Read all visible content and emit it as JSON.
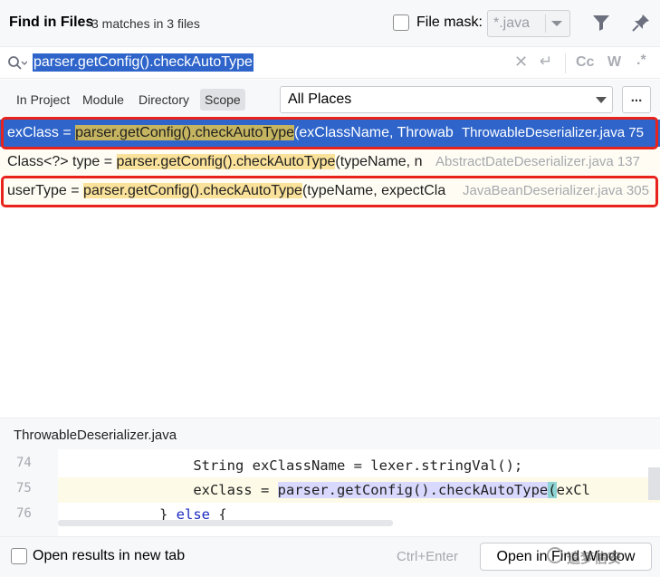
{
  "header": {
    "title": "Find in Files",
    "matches": "3 matches in 3 files",
    "file_mask_label": "File mask:",
    "file_mask_value": "*.java"
  },
  "search": {
    "query": "parser.getConfig().checkAutoType"
  },
  "toolbar": {
    "case_label": "Cc",
    "words_label": "W",
    "regex_label": ".*"
  },
  "scope": {
    "tabs": [
      "In Project",
      "Module",
      "Directory",
      "Scope"
    ],
    "selected_tab": "Scope",
    "places_value": "All Places",
    "more_label": "..."
  },
  "results": [
    {
      "prefix": "exClass = ",
      "match": "parser.getConfig().checkAutoType",
      "suffix": "(exClassName, Throwab",
      "file": "ThrowableDeserializer.java 75",
      "selected": true
    },
    {
      "prefix": "Class<?> type = ",
      "match": "parser.getConfig().checkAutoType",
      "suffix": "(typeName, n",
      "file": "AbstractDateDeserializer.java 137",
      "selected": false
    },
    {
      "prefix": "userType = ",
      "match": "parser.getConfig().checkAutoType",
      "suffix": "(typeName, expectCla",
      "file": "JavaBeanDeserializer.java 305",
      "selected": false
    }
  ],
  "preview": {
    "file_name": "ThrowableDeserializer.java",
    "lines": [
      {
        "number": "74",
        "indent": "                ",
        "before": "String exClassName = lexer.stringVal();",
        "match": "",
        "after": ""
      },
      {
        "number": "75",
        "indent": "                ",
        "before": "exClass = ",
        "match": "parser.getConfig().checkAutoType",
        "paren": "(",
        "after": "exCl"
      },
      {
        "number": "76",
        "indent": "            ",
        "before": "} ",
        "keyword": "else",
        "after": " {"
      }
    ]
  },
  "footer": {
    "open_new_tab_label": "Open results in new tab",
    "shortcut": "Ctrl+Enter",
    "open_button": "Open in Find Window",
    "watermark": "追梦信安"
  },
  "colors": {
    "selection": "#2f65ca",
    "match_highlight": "#fbe29a",
    "annotation_box": "#e8231c"
  }
}
